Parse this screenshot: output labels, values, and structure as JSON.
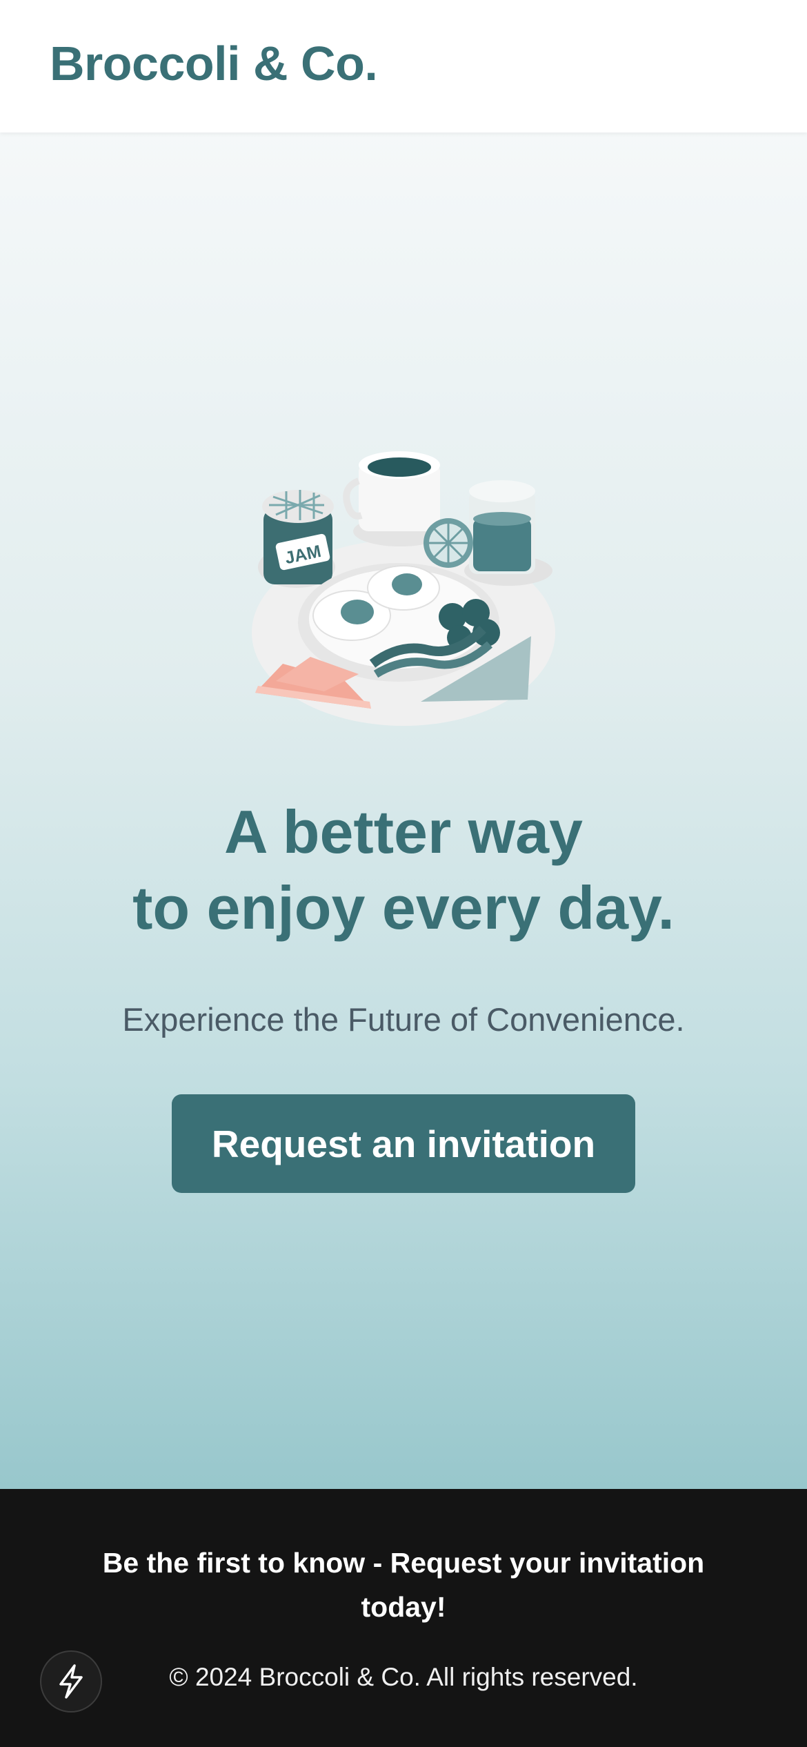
{
  "header": {
    "brand": "Broccoli & Co."
  },
  "hero": {
    "illustration_icon": "breakfast-illustration",
    "jam_label": "JAM",
    "headline_line1": "A better way",
    "headline_line2": "to enjoy every day.",
    "subtitle": "Experience the Future of Convenience.",
    "cta_label": "Request an invitation"
  },
  "footer": {
    "message": "Be the first to know - Request your invitation today!",
    "copyright": "© 2024 Broccoli & Co. All rights reserved.",
    "bolt_icon": "bolt-icon"
  },
  "colors": {
    "brand": "#3a7076",
    "footer_bg": "#141414",
    "subtitle": "#4a5a66"
  }
}
